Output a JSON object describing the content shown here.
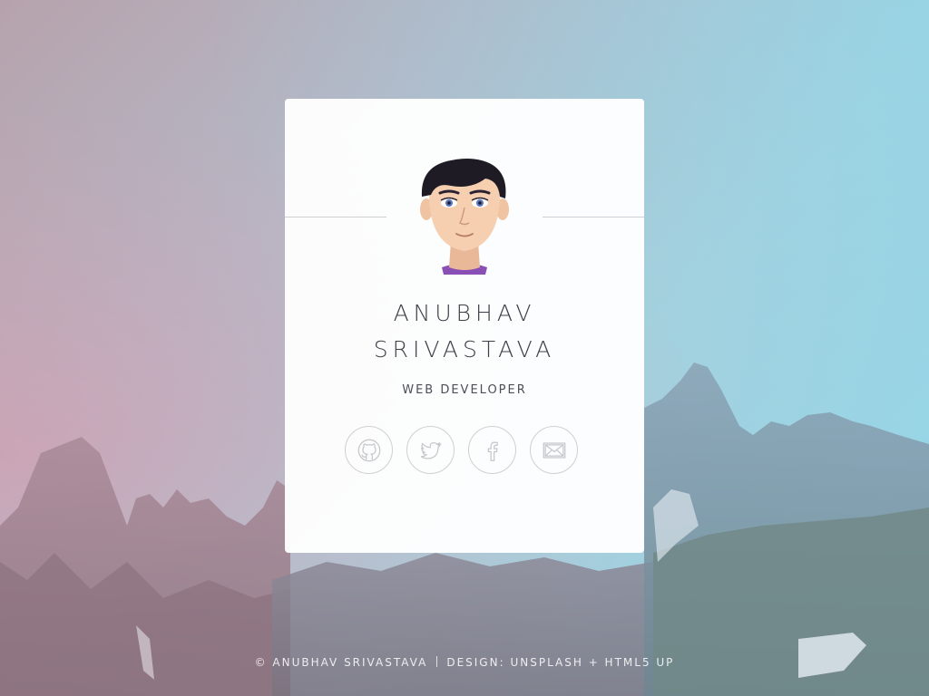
{
  "profile": {
    "first_name": "ANUBHAV",
    "last_name": "SRIVASTAVA",
    "role": "WEB DEVELOPER"
  },
  "social": [
    {
      "name": "github",
      "icon": "github-icon"
    },
    {
      "name": "twitter",
      "icon": "twitter-icon"
    },
    {
      "name": "facebook",
      "icon": "facebook-icon"
    },
    {
      "name": "email",
      "icon": "envelope-icon"
    }
  ],
  "footer": {
    "copyright": "© ANUBHAV SRIVASTAVA",
    "design_label": "DESIGN:",
    "design_link": "UNSPLASH + HTML5 UP"
  },
  "colors": {
    "card": "#ffffff",
    "text": "#3c4048",
    "icon": "#c4c6ca",
    "sky_left": "#c7a0b0",
    "sky_right": "#8fd8ea"
  }
}
